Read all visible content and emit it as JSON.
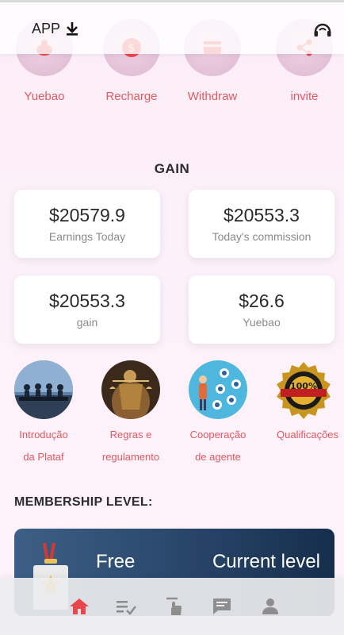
{
  "header": {
    "app_label": "APP"
  },
  "quick_actions": [
    {
      "label": "Yuebao",
      "icon": "piggy-bank-icon"
    },
    {
      "label": "Recharge",
      "icon": "dollar-coin-icon"
    },
    {
      "label": "Withdraw",
      "icon": "card-icon"
    },
    {
      "label": "invite",
      "icon": "share-icon"
    }
  ],
  "gain": {
    "title": "GAIN",
    "cards": [
      {
        "amount": "$20579.9",
        "label": "Earnings Today"
      },
      {
        "amount": "$20553.3",
        "label": "Today's commission"
      },
      {
        "amount": "$20553.3",
        "label": "gain"
      },
      {
        "amount": "$26.6",
        "label": "Yuebao"
      }
    ]
  },
  "features": [
    {
      "line1": "Introdução",
      "line2": "da Plataf"
    },
    {
      "line1": "Regras e",
      "line2": "regulamento"
    },
    {
      "line1": "Cooperação",
      "line2": "de agente"
    },
    {
      "line1": "Qualificações",
      "line2": ""
    }
  ],
  "membership": {
    "title": "MEMBERSHIP LEVEL:",
    "level_name": "Free",
    "current_label": "Current level"
  },
  "tabbar": [
    "home-icon",
    "task-list-icon",
    "tap-icon",
    "message-icon",
    "profile-icon"
  ],
  "colors": {
    "accent": "#e2595f",
    "tab_active": "#e8474c",
    "tab_inactive": "#8e8e8e"
  }
}
